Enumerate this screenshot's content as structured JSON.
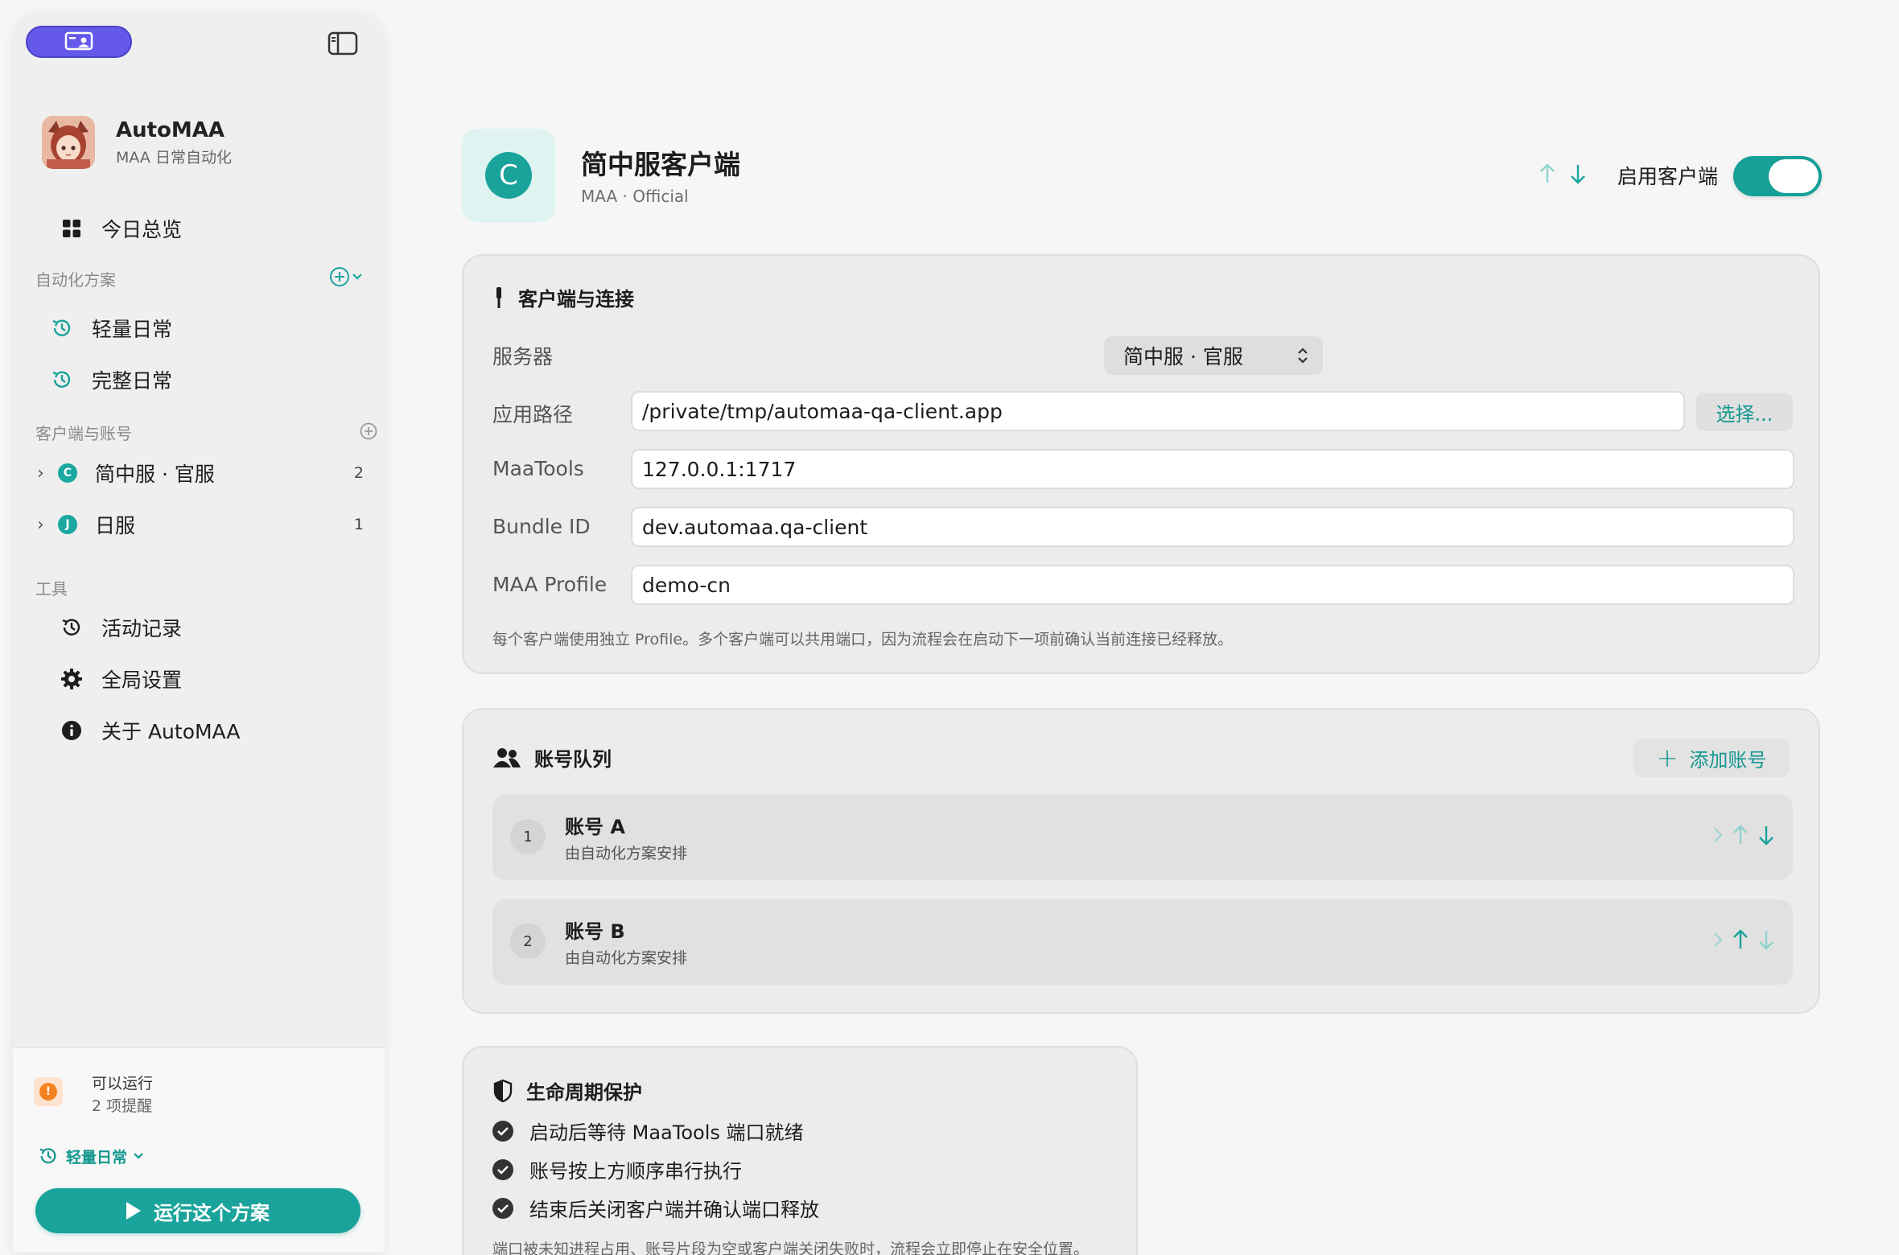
{
  "sidebar": {
    "app_name": "AutoMAA",
    "app_subtitle": "MAA 日常自动化",
    "overview": "今日总览",
    "plans_section": "自动化方案",
    "plans": [
      {
        "label": "轻量日常",
        "icon": "history-icon"
      },
      {
        "label": "完整日常",
        "icon": "history-icon"
      }
    ],
    "clients_section": "客户端与账号",
    "clients": [
      {
        "label": "简中服 · 官服",
        "badge": "C",
        "count": "2"
      },
      {
        "label": "日服",
        "badge": "J",
        "count": "1"
      }
    ],
    "tools_section": "工具",
    "tools": [
      {
        "label": "活动记录",
        "icon": "history-icon"
      },
      {
        "label": "全局设置",
        "icon": "gear-icon"
      },
      {
        "label": "关于 AutoMAA",
        "icon": "info-icon"
      }
    ],
    "footer": {
      "status": "可以运行",
      "reminders": "2 项提醒",
      "warn_glyph": "!",
      "current_plan": "轻量日常",
      "run_label": "运行这个方案"
    }
  },
  "header": {
    "logo_letter": "C",
    "title": "简中服客户端",
    "subtitle": "MAA · Official",
    "enable_label": "启用客户端",
    "enabled": true
  },
  "connection": {
    "title": "客户端与连接",
    "server_label": "服务器",
    "server_value": "简中服 · 官服",
    "path_label": "应用路径",
    "path_value": "/private/tmp/automaa-qa-client.app",
    "choose_label": "选择...",
    "maatools_label": "MaaTools",
    "maatools_value": "127.0.0.1:1717",
    "bundle_label": "Bundle ID",
    "bundle_value": "dev.automaa.qa-client",
    "profile_label": "MAA Profile",
    "profile_value": "demo-cn",
    "hint": "每个客户端使用独立 Profile。多个客户端可以共用端口，因为流程会在启动下一项前确认当前连接已经释放。"
  },
  "accounts": {
    "title": "账号队列",
    "add_label": "添加账号",
    "items": [
      {
        "num": "1",
        "name": "账号 A",
        "sub": "由自动化方案安排"
      },
      {
        "num": "2",
        "name": "账号 B",
        "sub": "由自动化方案安排"
      }
    ]
  },
  "lifecycle": {
    "title": "生命周期保护",
    "items": [
      "启动后等待 MaaTools 端口就绪",
      "账号按上方顺序串行执行",
      "结束后关闭客户端并确认端口释放"
    ],
    "note": "端口被未知进程占用、账号片段为空或客户端关闭失败时，流程会立即停止在安全位置。"
  },
  "colors": {
    "accent": "#1aa39b",
    "brand_purple": "#6459e8",
    "warning": "#f5821f"
  }
}
